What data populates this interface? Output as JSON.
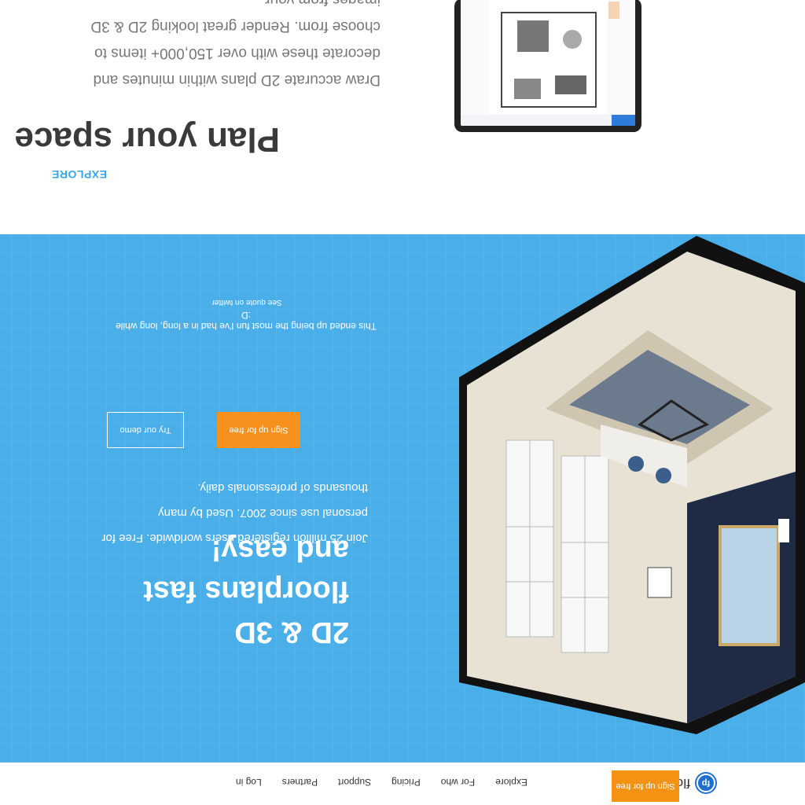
{
  "nav": {
    "brand": "floorplanner",
    "links": [
      "Explore",
      "For who",
      "Pricing",
      "Support",
      "Partners",
      "Log in"
    ],
    "signup": "Sign up for free"
  },
  "hero": {
    "title": "2D & 3D floorplans fast and easy!",
    "description": "Join 25 million registered users worldwide. Free for personal use since 2007. Used by many thousands of professionals daily.",
    "signup_button": "Sign up for free",
    "demo_button": "Try our demo",
    "quote": "This ended up being the most fun I've had in a long, long while :D",
    "quote_link": "See quote on twitter"
  },
  "plan": {
    "explore": "EXPLORE",
    "title": "Plan your space",
    "description": "Draw accurate 2D plans within minutes and decorate these with over 150,000+ items to choose from. Render great looking 2D & 3D images from your"
  },
  "colors": {
    "hero_bg": "#4aaee9",
    "accent_orange": "#f5911c",
    "link_blue": "#3aa6e8",
    "brand_blue": "#1f6fd1"
  }
}
